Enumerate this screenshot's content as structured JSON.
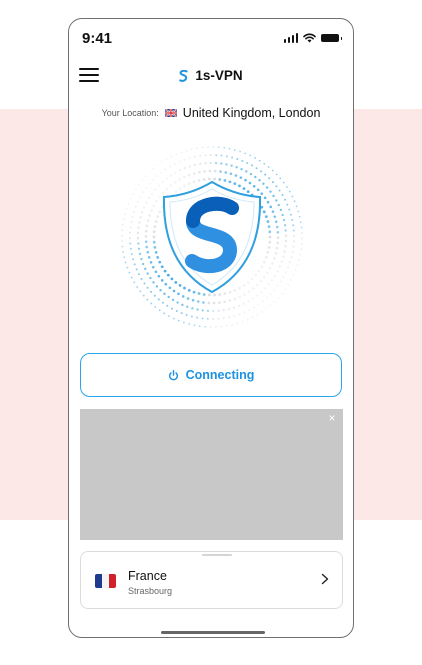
{
  "status_bar": {
    "time": "9:41"
  },
  "header": {
    "app_title": "1s-VPN"
  },
  "location": {
    "label": "Your Location:",
    "value": "United Kingdom, London"
  },
  "connection": {
    "button_label": "Connecting"
  },
  "ad": {
    "close_symbol": "×"
  },
  "server": {
    "country": "France",
    "city": "Strasbourg"
  },
  "colors": {
    "accent": "#1d93e0",
    "button_border": "#2aa6e8",
    "background_band": "#fde8e8",
    "ad_placeholder": "#c8c8c8"
  },
  "icons": [
    "menu-icon",
    "vpn-logo-icon",
    "uk-flag-icon",
    "shield-logo-icon",
    "power-icon",
    "close-icon",
    "france-flag-icon",
    "chevron-right-icon",
    "signal-icon",
    "wifi-icon",
    "battery-icon"
  ]
}
